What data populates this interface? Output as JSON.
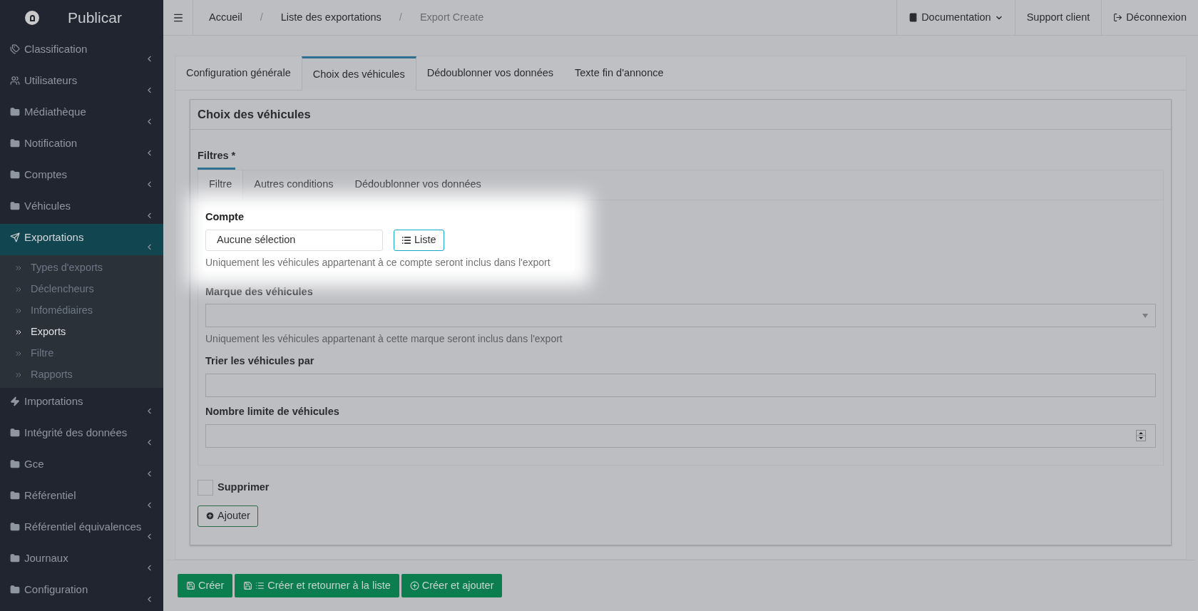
{
  "sidebar": {
    "brand": "Publicar",
    "items": [
      {
        "label": "Classification",
        "kind": "tags",
        "selected": false
      },
      {
        "label": "Utilisateurs",
        "kind": "users",
        "selected": false
      },
      {
        "label": "Médiathèque",
        "kind": "folder",
        "selected": false
      },
      {
        "label": "Notification",
        "kind": "folder",
        "selected": false
      },
      {
        "label": "Comptes",
        "kind": "folder",
        "selected": false
      },
      {
        "label": "Véhicules",
        "kind": "folder",
        "selected": false
      },
      {
        "label": "Exportations",
        "kind": "send",
        "selected": true,
        "expanded": true,
        "children": [
          {
            "label": "Types d'exports",
            "selected": false
          },
          {
            "label": "Déclencheurs",
            "selected": false
          },
          {
            "label": "Infomédiaires",
            "selected": false
          },
          {
            "label": "Exports",
            "selected": true
          },
          {
            "label": "Filtre",
            "selected": false
          },
          {
            "label": "Rapports",
            "selected": false
          }
        ]
      },
      {
        "label": "Importations",
        "kind": "bolt",
        "selected": false
      },
      {
        "label": "Intégrité des données",
        "kind": "folder",
        "selected": false
      },
      {
        "label": "Gce",
        "kind": "folder",
        "selected": false
      },
      {
        "label": "Référentiel",
        "kind": "folder",
        "selected": false
      },
      {
        "label": "Référentiel équivalences",
        "kind": "folder",
        "selected": false
      },
      {
        "label": "Journaux",
        "kind": "folder",
        "selected": false
      },
      {
        "label": "Configuration",
        "kind": "folder",
        "selected": false
      }
    ]
  },
  "breadcrumbs": [
    {
      "label": "Accueil",
      "current": false
    },
    {
      "label": "Liste des exportations",
      "current": false
    },
    {
      "label": "Export Create",
      "current": true
    }
  ],
  "breadcrumb_separator": "/",
  "top_links": [
    {
      "label": "Documentation",
      "kind": "docs"
    },
    {
      "label": "Support client",
      "kind": "plain"
    },
    {
      "label": "Déconnexion",
      "kind": "logout"
    }
  ],
  "tabs": [
    {
      "label": "Configuration générale",
      "selected": false
    },
    {
      "label": "Choix des véhicules",
      "selected": true
    },
    {
      "label": "Dédoublonner vos données",
      "selected": false
    },
    {
      "label": "Texte fin d'annonce",
      "selected": false
    }
  ],
  "card": {
    "title": "Choix des véhicules",
    "section": "Filtres *",
    "subtabs": [
      {
        "label": "Filtre",
        "selected": true
      },
      {
        "label": "Autres conditions",
        "selected": false
      },
      {
        "label": "Dédoublonner vos données",
        "selected": false
      }
    ],
    "fields": [
      {
        "kind": "picker",
        "label": "Compte",
        "value": "Aucune sélection",
        "button": "Liste",
        "help": "Uniquement les véhicules appartenant à ce compte seront inclus dans l'export",
        "highlighted": true
      },
      {
        "kind": "select",
        "label": "Marque des véhicules",
        "help": "Uniquement les véhicules appartenant à cette marque seront inclus dans l'export",
        "highlighted": false
      },
      {
        "kind": "text",
        "label": "Trier les véhicules par",
        "highlighted": false
      },
      {
        "kind": "number",
        "label": "Nombre limite de véhicules",
        "highlighted": false
      }
    ],
    "delete": {
      "label": "Supprimer",
      "checked": false
    },
    "add_button": "Ajouter"
  },
  "actions": [
    {
      "label": "Créer",
      "kind": "save"
    },
    {
      "label": "Créer et retourner à la liste",
      "kind": "save_list"
    },
    {
      "label": "Créer et ajouter",
      "kind": "add"
    }
  ]
}
